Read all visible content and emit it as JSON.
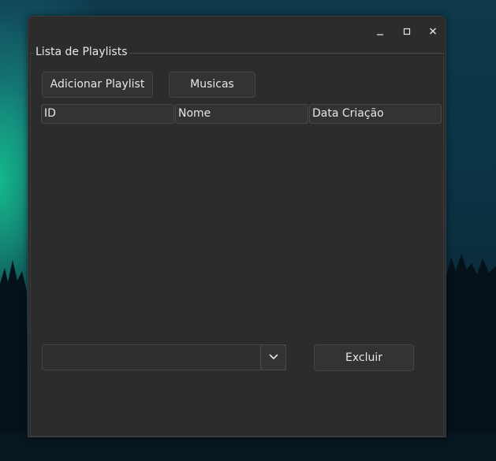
{
  "window": {
    "controls": {
      "minimize_icon": "minimize-icon",
      "maximize_icon": "maximize-icon",
      "close_icon": "close-icon"
    }
  },
  "group": {
    "title": "Lista de Playlists"
  },
  "toolbar": {
    "add_playlist_label": "Adicionar Playlist",
    "musics_label": "Musicas"
  },
  "table": {
    "columns": [
      "ID",
      "Nome",
      "Data Criação"
    ],
    "rows": []
  },
  "footer": {
    "playlist_select_value": "",
    "delete_label": "Excluir"
  },
  "colors": {
    "window_bg": "#2c2c2c",
    "button_bg": "#333333",
    "text": "#e6e6e6",
    "desktop_accent": "#14be8c"
  }
}
